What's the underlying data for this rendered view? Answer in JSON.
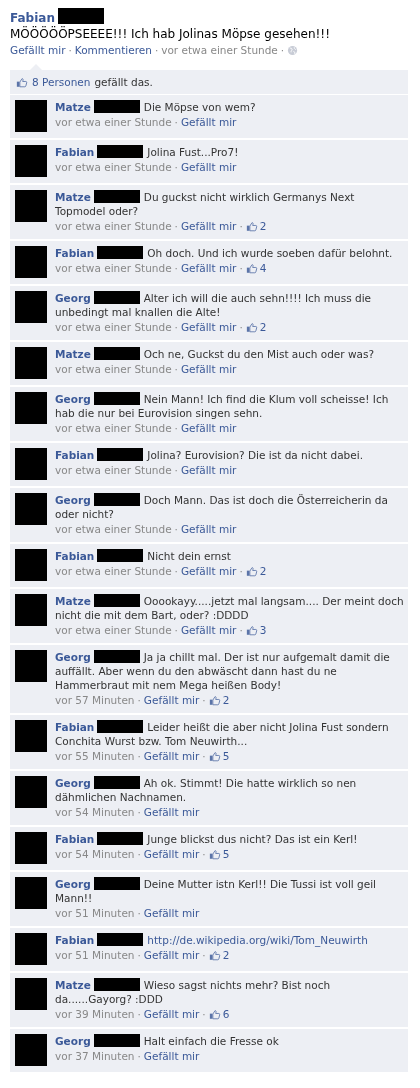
{
  "separator": "·",
  "post": {
    "author": "Fabian",
    "text": "MÖÖÖÖÖPSEEEE!!! Ich hab Jolinas Möpse gesehen!!!",
    "actions": [
      "Gefällt mir",
      "Kommentieren"
    ],
    "time": "vor etwa einer Stunde"
  },
  "likes_bar": {
    "link": "8 Personen",
    "text": "gefällt das."
  },
  "comments": [
    {
      "author": "Matze",
      "kind": "text",
      "text": "Die Möpse von wem?",
      "time": "vor etwa einer Stunde",
      "action": "Gefällt mir"
    },
    {
      "author": "Fabian",
      "kind": "text",
      "text": "Jolina Fust...Pro7!",
      "time": "vor etwa einer Stunde",
      "action": "Gefällt mir"
    },
    {
      "author": "Matze",
      "kind": "text",
      "text": "Du guckst nicht wirklich Germanys Next Topmodel oder?",
      "time": "vor etwa einer Stunde",
      "action": "Gefällt mir",
      "likes": "2"
    },
    {
      "author": "Fabian",
      "kind": "text",
      "text": "Oh doch. Und ich wurde soeben dafür belohnt.",
      "time": "vor etwa einer Stunde",
      "action": "Gefällt mir",
      "likes": "4"
    },
    {
      "author": "Georg",
      "kind": "text",
      "text": "Alter ich will die auch sehn!!!! Ich muss die unbedingt mal knallen die Alte!",
      "time": "vor etwa einer Stunde",
      "action": "Gefällt mir",
      "likes": "2"
    },
    {
      "author": "Matze",
      "kind": "text",
      "text": "Och ne, Guckst du den Mist auch oder was?",
      "time": "vor etwa einer Stunde",
      "action": "Gefällt mir"
    },
    {
      "author": "Georg",
      "kind": "text",
      "text": "Nein Mann! Ich find die Klum voll scheisse! Ich hab die nur bei Eurovision singen sehn.",
      "time": "vor etwa einer Stunde",
      "action": "Gefällt mir"
    },
    {
      "author": "Fabian",
      "kind": "text",
      "text": "Jolina? Eurovision? Die ist da nicht dabei.",
      "time": "vor etwa einer Stunde",
      "action": "Gefällt mir"
    },
    {
      "author": "Georg",
      "kind": "text",
      "text": "Doch Mann. Das ist doch die Österreicherin da oder nicht?",
      "time": "vor etwa einer Stunde",
      "action": "Gefällt mir"
    },
    {
      "author": "Fabian",
      "kind": "text",
      "text": "Nicht dein ernst",
      "time": "vor etwa einer Stunde",
      "action": "Gefällt mir",
      "likes": "2"
    },
    {
      "author": "Matze",
      "kind": "text",
      "text": "Ooookayy.....jetzt mal langsam.... Der meint doch nicht die mit dem Bart, oder? :DDDD",
      "time": "vor etwa einer Stunde",
      "action": "Gefällt mir",
      "likes": "3"
    },
    {
      "author": "Georg",
      "kind": "text",
      "text": "Ja ja chillt mal. Der ist nur aufgemalt damit die auffällt. Aber wenn du den abwäscht dann hast du ne Hammerbraut mit nem Mega heißen Body!",
      "time": "vor 57 Minuten",
      "action": "Gefällt mir",
      "likes": "2"
    },
    {
      "author": "Fabian",
      "kind": "text",
      "text": "Leider heißt die aber nicht Jolina Fust sondern Conchita Wurst bzw. Tom Neuwirth...",
      "time": "vor 55 Minuten",
      "action": "Gefällt mir",
      "likes": "5"
    },
    {
      "author": "Georg",
      "kind": "text",
      "text": "Ah ok. Stimmt! Die hatte wirklich so nen dähmlichen Nachnamen.",
      "time": "vor 54 Minuten",
      "action": "Gefällt mir"
    },
    {
      "author": "Fabian",
      "kind": "text",
      "text": "Junge blickst dus nicht? Das ist ein Kerl!",
      "time": "vor 54 Minuten",
      "action": "Gefällt mir",
      "likes": "5"
    },
    {
      "author": "Georg",
      "kind": "text",
      "text": "Deine Mutter istn Kerl!! Die Tussi ist voll geil Mann!!",
      "time": "vor 51 Minuten",
      "action": "Gefällt mir"
    },
    {
      "author": "Fabian",
      "kind": "link",
      "text": "http://de.wikipedia.org/wiki/Tom_Neuwirth",
      "time": "vor 51 Minuten",
      "action": "Gefällt mir",
      "likes": "2"
    },
    {
      "author": "Matze",
      "kind": "text",
      "text": "Wieso sagst nichts mehr? Bist noch da......Gayorg? :DDD",
      "time": "vor 39 Minuten",
      "action": "Gefällt mir",
      "likes": "6"
    },
    {
      "author": "Georg",
      "kind": "text",
      "text": "Halt einfach die Fresse ok",
      "time": "vor 37 Minuten",
      "action": "Gefällt mir"
    }
  ]
}
